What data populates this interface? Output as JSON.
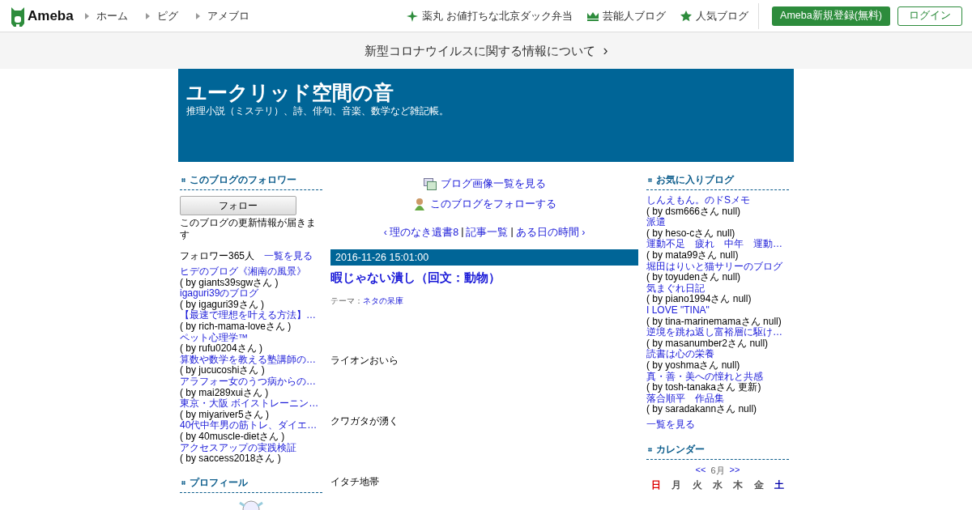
{
  "topbar": {
    "logo": "Ameba",
    "nav": [
      "ホーム",
      "ピグ",
      "アメブロ"
    ],
    "links": [
      {
        "kind": "sparkle",
        "label": "薬丸 お値打ちな北京ダック弁当"
      },
      {
        "kind": "crown",
        "label": "芸能人ブログ"
      },
      {
        "kind": "star",
        "label": "人気ブログ"
      }
    ],
    "register_button": "Ameba新規登録(無料)",
    "login_button": "ログイン"
  },
  "notice": {
    "text": "新型コロナウイルスに関する情報について",
    "arrow": "›"
  },
  "blog_header": {
    "title": "ユークリッド空間の音",
    "description": "推理小説（ミステリ）、詩、俳句、音楽、数学など雑記帳。"
  },
  "left": {
    "followers": {
      "heading": "このブログのフォロワー",
      "follow_button": "フォロー",
      "note": "このブログの更新情報が届きます",
      "count": "フォロワー365人",
      "see_all": "一覧を見る",
      "items": [
        {
          "title": "ヒデのブログ《湘南の風景》",
          "by": "( by giants39sgwさん )"
        },
        {
          "title": "igaguri39のブログ",
          "by": "( by igaguri39さん )"
        },
        {
          "title": "【最速で理想を叶える方法】…",
          "by": "( by rich-mama-loveさん )"
        },
        {
          "title": "ペット心理学™",
          "by": "( by rufu0204さん )"
        },
        {
          "title": "算数や数学を教える塾講師の…",
          "by": "( by jucucoshiさん )"
        },
        {
          "title": "アラフォー女のうつ病からの…",
          "by": "( by mai289xuiさん )"
        },
        {
          "title": "東京・大阪 ボイストレーニン…",
          "by": "( by miyariver5さん )"
        },
        {
          "title": "40代中年男の筋トレ、ダイエ…",
          "by": "( by 40muscle-dietさん )"
        },
        {
          "title": "アクセスアップの実践検証",
          "by": "( by saccess2018さん )"
        }
      ]
    },
    "profile": {
      "heading": "プロフィール"
    }
  },
  "center": {
    "image_link": "ブログ画像一覧を見る",
    "follow_link": "このブログをフォローする",
    "pager": {
      "prev_arrow": "‹",
      "prev": "理のなき遺書8",
      "separators": [
        "|",
        "|"
      ],
      "list": "記事一覧",
      "next": "ある日の時間",
      "next_arrow": "›"
    },
    "post": {
      "date": "2016-11-26 15:01:00",
      "title": "暇じゃない潰し（回文：動物）",
      "theme_label": "テーマ：",
      "theme": "ネタの呆庫",
      "lines": [
        "ライオンおいら",
        "クワガタが湧く",
        "イタチ地帯"
      ]
    }
  },
  "right": {
    "favorites": {
      "heading": "お気に入りブログ",
      "see_all": "一覧を見る",
      "items": [
        {
          "title": "しんえもん。のドSメモ",
          "by": "( by dsm666さん null)"
        },
        {
          "title": "派遣",
          "by": "( by heso-cさん null)"
        },
        {
          "title": "運動不足　疲れ　中年　運動…",
          "by": "( by mata99さん null)"
        },
        {
          "title": "堀田はりいと猫サリーのブログ",
          "by": "( by toyudenさん null)"
        },
        {
          "title": "気まぐれ日記",
          "by": "( by piano1994さん null)"
        },
        {
          "title": "I LOVE \"TINA\"",
          "by": "( by tina-marinemamaさん null)"
        },
        {
          "title": "逆境を跳ね返し富裕層に駆け…",
          "by": "( by masanumber2さん null)"
        },
        {
          "title": "読書は心の栄養",
          "by": "( by yoshmaさん null)"
        },
        {
          "title": "真・善・美への憧れと共感",
          "by": "( by tosh-tanakaさん 更新)"
        },
        {
          "title": "落合順平　作品集",
          "by": "( by saradakannさん null)"
        }
      ]
    },
    "calendar": {
      "heading": "カレンダー",
      "prev": "<<",
      "month": "6月",
      "next": ">>",
      "weekdays": [
        {
          "label": "日",
          "color": "#dd0000"
        },
        {
          "label": "月",
          "color": "#555555"
        },
        {
          "label": "火",
          "color": "#555555"
        },
        {
          "label": "水",
          "color": "#555555"
        },
        {
          "label": "木",
          "color": "#555555"
        },
        {
          "label": "金",
          "color": "#555555"
        },
        {
          "label": "土",
          "color": "#0000aa"
        }
      ]
    }
  }
}
